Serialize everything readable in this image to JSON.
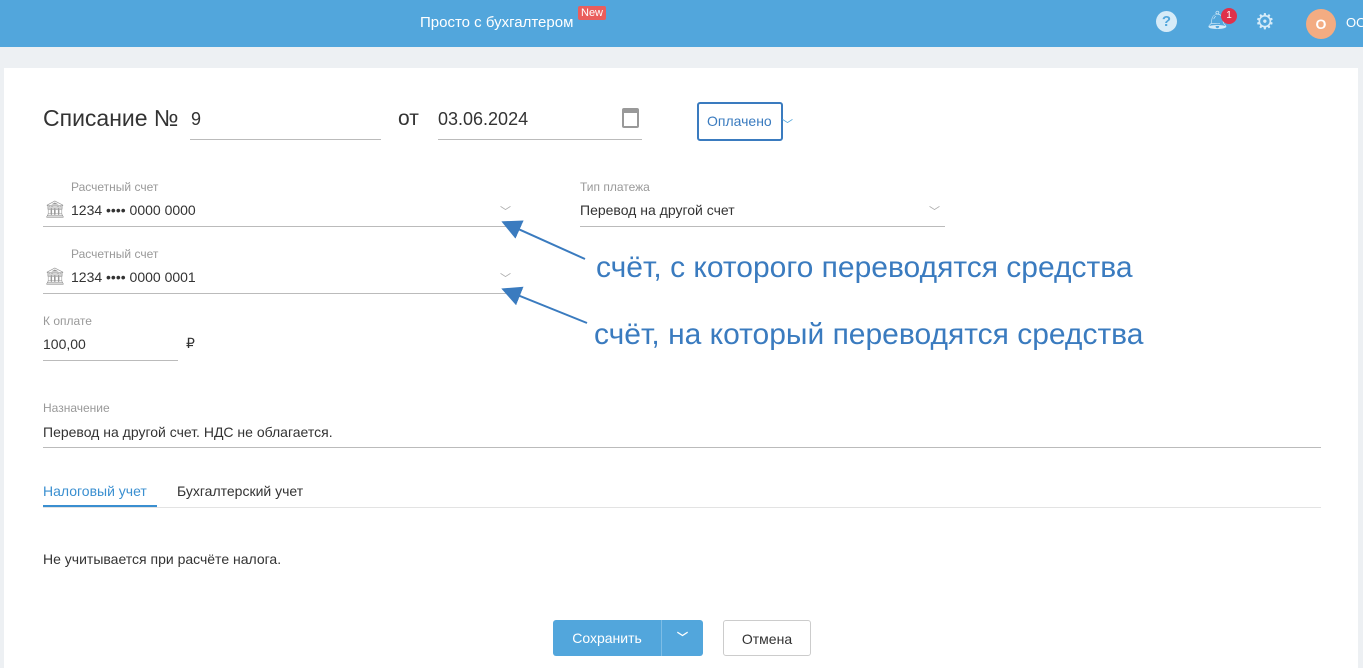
{
  "header": {
    "brand": "Просто с бухгалтером",
    "new_badge": "New",
    "notifications": "1",
    "avatar": "О",
    "org": "ОО"
  },
  "doc": {
    "title": "Списание №",
    "number": "9",
    "from": "от",
    "date": "03.06.2024",
    "status": "Оплачено"
  },
  "account_from": {
    "label": "Расчетный счет",
    "value": "1234 •••• 0000 0000"
  },
  "account_to": {
    "label": "Расчетный счет",
    "value": "1234 •••• 0000 0001"
  },
  "payment_type": {
    "label": "Тип платежа",
    "value": "Перевод на другой счет"
  },
  "amount": {
    "label": "К оплате",
    "value": "100,00",
    "currency": "₽"
  },
  "purpose": {
    "label": "Назначение",
    "value": "Перевод на другой счет. НДС не облагается."
  },
  "tabs": [
    "Налоговый учет",
    "Бухгалтерский учет"
  ],
  "tax_text": "Не учитывается при расчёте налога.",
  "annotations": [
    "счёт, с которого переводятся средства",
    "счёт, на который переводятся средства"
  ],
  "buttons": {
    "save": "Сохранить",
    "cancel": "Отмена"
  }
}
